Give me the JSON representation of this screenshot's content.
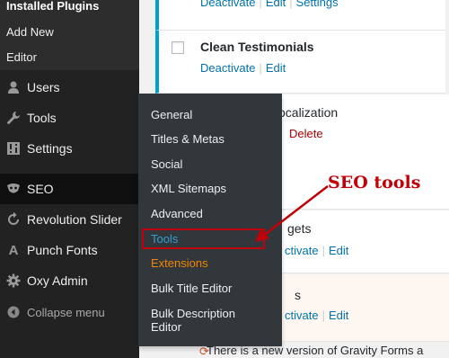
{
  "sidebar": {
    "submenu": {
      "current": "Installed Plugins",
      "items": [
        "Add New",
        "Editor"
      ]
    },
    "menu": [
      {
        "label": "Users",
        "icon": "users-icon"
      },
      {
        "label": "Tools",
        "icon": "wrench-icon"
      },
      {
        "label": "Settings",
        "icon": "settings-icon"
      },
      {
        "label": "SEO",
        "icon": "yoast-seo-icon"
      },
      {
        "label": "Revolution Slider",
        "icon": "refresh-icon"
      },
      {
        "label": "Punch Fonts",
        "icon": "font-a-icon"
      },
      {
        "label": "Oxy Admin",
        "icon": "gear-icon"
      }
    ],
    "collapse_label": "Collapse menu"
  },
  "flyout": {
    "items": [
      "General",
      "Titles & Metas",
      "Social",
      "XML Sitemaps",
      "Advanced",
      "Tools",
      "Extensions",
      "Bulk Title Editor",
      "Bulk Description Editor"
    ]
  },
  "plugins": [
    {
      "title": "",
      "actions": [
        "Deactivate",
        "Edit",
        "Settings"
      ]
    },
    {
      "title": "Clean Testimonials",
      "actions": [
        "Deactivate",
        "Edit"
      ]
    },
    {
      "title_fragment": "ocalization",
      "actions_fragment": "Delete"
    },
    {
      "title_fragment": "gets",
      "actions": [
        "ctivate",
        "Edit"
      ]
    },
    {
      "title_fragment": "s",
      "actions": [
        "ctivate",
        "Edit"
      ]
    }
  ],
  "update_notice": "There is a new version of Gravity Forms a",
  "annotation": {
    "label": "SEO tools",
    "color": "#c20008"
  },
  "colors": {
    "sidebar_bg": "#222222",
    "flyout_bg": "#32373c",
    "link": "#0073aa",
    "highlight": "#2ea2cc",
    "extensions": "#f18500"
  }
}
